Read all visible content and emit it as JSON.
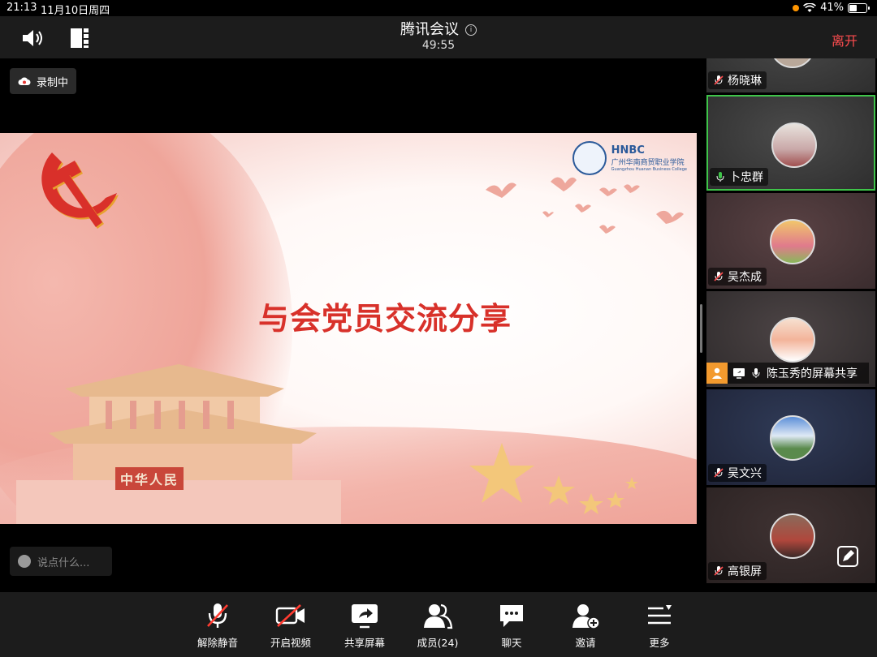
{
  "status_bar": {
    "time": "21:13",
    "date": "11月10日周四",
    "battery": "41%",
    "battery_level": 0.41
  },
  "header": {
    "title": "腾讯会议",
    "timer": "49:55",
    "leave_label": "离开"
  },
  "main": {
    "recording_label": "录制中",
    "chat_placeholder": "说点什么...",
    "slide": {
      "title": "与会党员交流分享",
      "logo_en": "HNBC",
      "logo_cn": "广州华南商贸职业学院",
      "logo_sub": "Guangzhou Huanan Business College",
      "gate_text": "中华人民"
    }
  },
  "participants": [
    {
      "name": "杨晓琳",
      "mic": "muted",
      "active": false
    },
    {
      "name": "卜忠群",
      "mic": "on",
      "active": true
    },
    {
      "name": "吴杰成",
      "mic": "muted",
      "active": false
    },
    {
      "name": "陈玉秀的屏幕共享",
      "mic": "on",
      "active": false,
      "sharing": true
    },
    {
      "name": "吴文兴",
      "mic": "muted",
      "active": false
    },
    {
      "name": "高银屏",
      "mic": "muted",
      "active": false
    }
  ],
  "toolbar": {
    "unmute": "解除静音",
    "video": "开启视频",
    "share": "共享屏幕",
    "members": "成员(24)",
    "chat": "聊天",
    "invite": "邀请",
    "more": "更多"
  },
  "colors": {
    "leave": "#ff4d4f",
    "active_border": "#3fc44a",
    "share_user": "#f39a2e",
    "slide_title": "#d8312a"
  }
}
